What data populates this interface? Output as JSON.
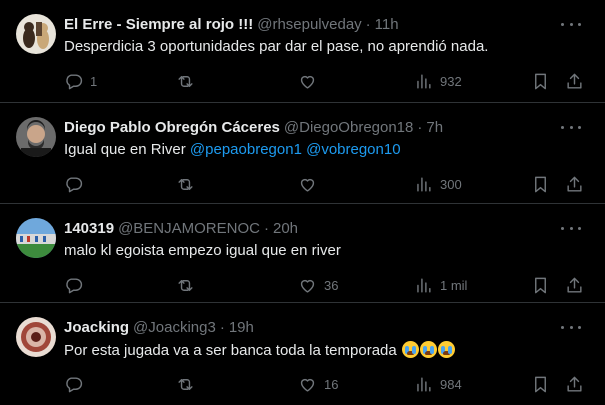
{
  "tweets": [
    {
      "name": "El Erre - Siempre al rojo !!!",
      "handle": "@rhsepulveday",
      "time": "11h",
      "text": "Desperdicia 3 oportunidades par dar el pase, no aprendió nada.",
      "reply_count": "1",
      "retweet_count": "",
      "like_count": "",
      "view_count": "932"
    },
    {
      "name": "Diego Pablo Obregón Cáceres",
      "handle": "@DiegoObregon18",
      "time": "7h",
      "text_prefix": "Igual que en River ",
      "mention1": "@pepaobregon1",
      "mention2": "@vobregon10",
      "reply_count": "",
      "retweet_count": "",
      "like_count": "",
      "view_count": "300"
    },
    {
      "name": "140319",
      "handle": "@BENJAMORENOC",
      "time": "20h",
      "text": "malo kl egoista empezo igual que en river",
      "reply_count": "",
      "retweet_count": "",
      "like_count": "36",
      "view_count": "1 mil"
    },
    {
      "name": "Joacking",
      "handle": "@Joacking3",
      "time": "19h",
      "text": "Por esta jugada va a ser banca toda la temporada",
      "emoji": [
        "loudly-crying-face",
        "loudly-crying-face",
        "loudly-crying-face"
      ],
      "reply_count": "",
      "retweet_count": "",
      "like_count": "16",
      "view_count": "984"
    }
  ],
  "separator": "·",
  "icons": {
    "reply": "reply-icon",
    "retweet": "retweet-icon",
    "like": "heart-icon",
    "views": "views-icon",
    "bookmark": "bookmark-icon",
    "share": "share-icon",
    "more": "more-icon"
  },
  "colors": {
    "background": "#000000",
    "text": "#e7e9ea",
    "secondary": "#71767b",
    "link": "#1d9bf0",
    "divider": "#2f3336"
  }
}
